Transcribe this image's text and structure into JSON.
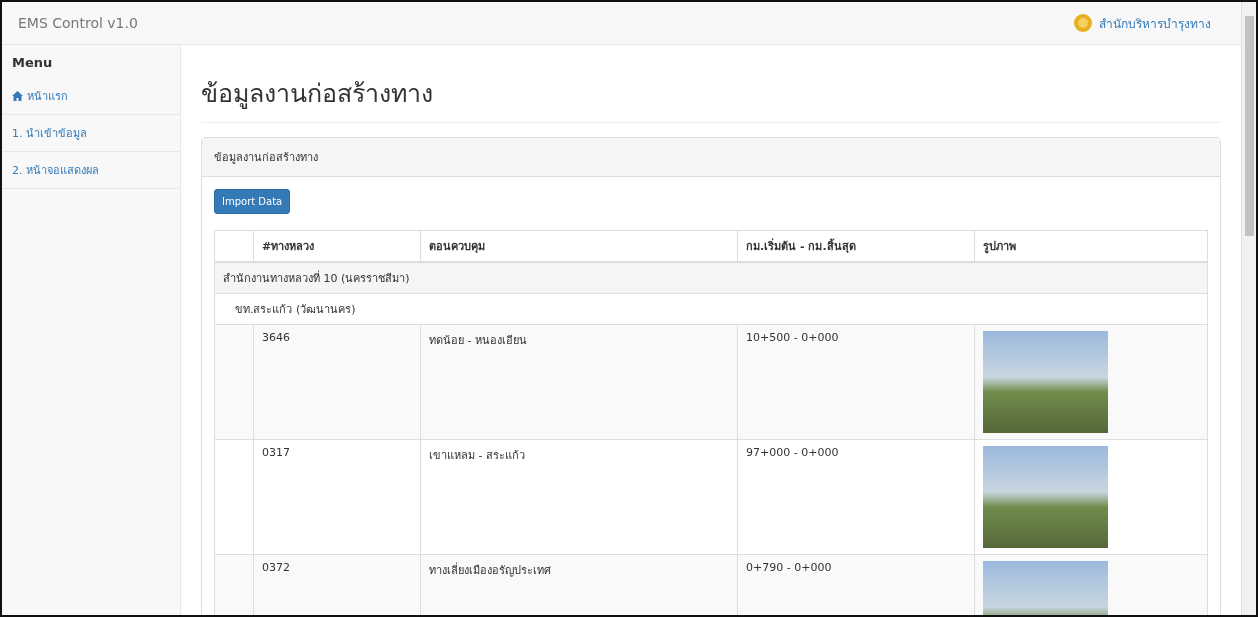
{
  "navbar": {
    "brand": "EMS Control v1.0",
    "agency": "สำนักบริหารบำรุงทาง"
  },
  "sidebar": {
    "title": "Menu",
    "items": [
      {
        "label": "หน้าแรก",
        "kind": "home"
      },
      {
        "label": "1. นำเข้าข้อมูล",
        "kind": "plain"
      },
      {
        "label": "2. หน้าจอแสดงผล",
        "kind": "plain"
      }
    ]
  },
  "page_title": "ข้อมูลงานก่อสร้างทาง",
  "panel": {
    "heading": "ข้อมูลงานก่อสร้างทาง",
    "button": "Import Data",
    "table": {
      "columns": [
        "#ทางหลวง",
        "ตอนควบคุม",
        "กม.เริ่มต้น - กม.สิ้นสุด",
        "รูปภาพ"
      ],
      "rows": [
        {
          "kind": "group",
          "text": "สำนักงานทางหลวงที่ 10 (นครราชสีมา)"
        },
        {
          "kind": "subgroup",
          "text": "ขท.สระแก้ว (วัฒนานคร)"
        },
        {
          "kind": "data",
          "road": "3646",
          "section": "ทดน้อย - หนองเอียน",
          "km": "10+500 - 0+000"
        },
        {
          "kind": "data",
          "road": "0317",
          "section": "เขาแหลม - สระแก้ว",
          "km": "97+000 - 0+000"
        },
        {
          "kind": "data",
          "road": "0372",
          "section": "ทางเลี่ยงเมืองอรัญประเทศ",
          "km": "0+790 - 0+000"
        }
      ]
    }
  }
}
